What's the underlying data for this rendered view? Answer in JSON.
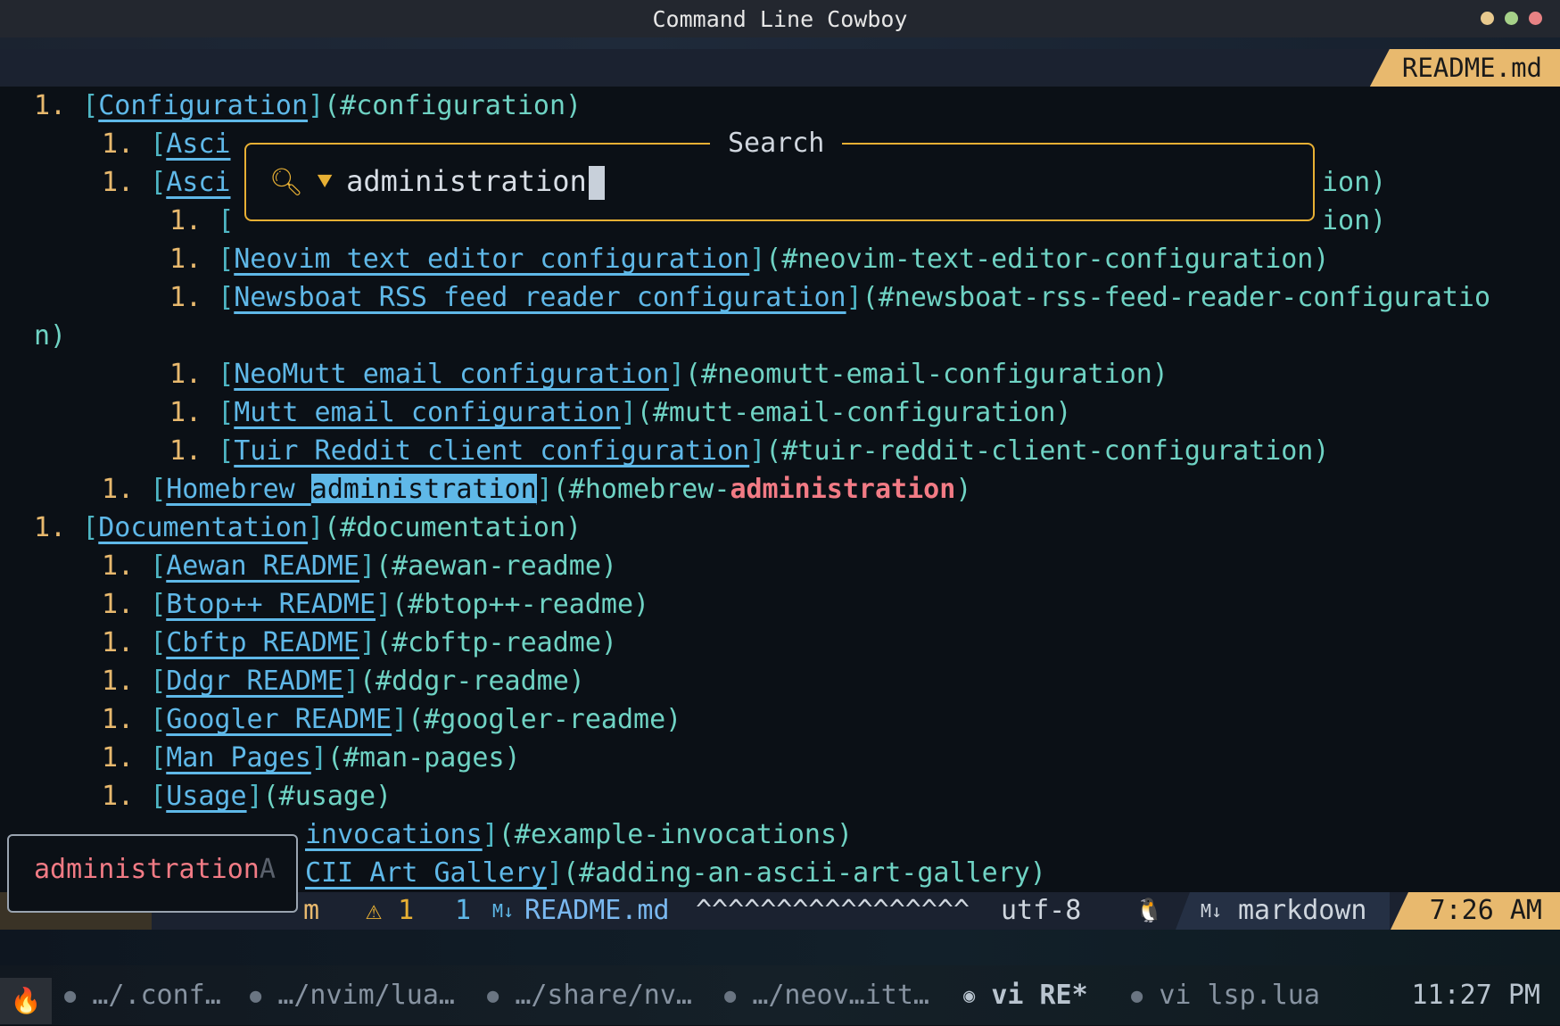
{
  "window": {
    "title": "Command Line Cowboy"
  },
  "tab": {
    "filename": "README.md"
  },
  "editor_lines": {
    "l1": {
      "num": "1. ",
      "text": "Configuration",
      "url": "(#configuration)"
    },
    "l2": {
      "num": "1. ",
      "text": "Asci"
    },
    "l3": {
      "num": "1. ",
      "text": "Asci",
      "tail": "ion)"
    },
    "l4": {
      "num": "1. ",
      "tail": "ion)"
    },
    "l5": {
      "num": "1. ",
      "text": "Neovim text editor configuration",
      "url": "(#neovim-text-editor-configuration)"
    },
    "l6": {
      "num": "1. ",
      "text": "Newsboat RSS feed reader configuration",
      "url": "(#newsboat-rss-feed-reader-configuratio"
    },
    "l6wrap": "n)",
    "l7": {
      "num": "1. ",
      "text": "NeoMutt email configuration",
      "url": "(#neomutt-email-configuration)"
    },
    "l8": {
      "num": "1. ",
      "text": "Mutt email configuration",
      "url": "(#mutt-email-configuration)"
    },
    "l9": {
      "num": "1. ",
      "text": "Tuir Reddit client configuration",
      "url": "(#tuir-reddit-client-configuration)"
    },
    "l10": {
      "num": "1. ",
      "text_a": "Homebrew ",
      "text_b": "administration",
      "url_a": "(#homebrew-",
      "url_b": "administration",
      "url_c": ")"
    },
    "l11": {
      "num": "1. ",
      "text": "Documentation",
      "url": "(#documentation)"
    },
    "l12": {
      "num": "1. ",
      "text": "Aewan README",
      "url": "(#aewan-readme)"
    },
    "l13": {
      "num": "1. ",
      "text": "Btop++ README",
      "url": "(#btop++-readme)"
    },
    "l14": {
      "num": "1. ",
      "text": "Cbftp README",
      "url": "(#cbftp-readme)"
    },
    "l15": {
      "num": "1. ",
      "text": "Ddgr README",
      "url": "(#ddgr-readme)"
    },
    "l16": {
      "num": "1. ",
      "text": "Googler README",
      "url": "(#googler-readme)"
    },
    "l17": {
      "num": "1. ",
      "text": "Man Pages",
      "url": "(#man-pages)"
    },
    "l18": {
      "num": "1. ",
      "text": "Usage",
      "url": "(#usage)"
    },
    "l19": {
      "text": "invocations",
      "url": "(#example-invocations)"
    },
    "l20": {
      "text": "CII Art Gallery",
      "url": "(#adding-an-ascii-art-gallery)"
    }
  },
  "search": {
    "title": "Search",
    "query": "administration"
  },
  "completion": {
    "match": "administration",
    "ghost": "A"
  },
  "statusline": {
    "mode": "m",
    "warn_icon": "⚠",
    "warn_count": "1",
    "hint_count": "1",
    "file_icon": "M↓",
    "filename": "README.md",
    "carets": "^^^^^^^^^^^^^^^^^",
    "encoding": "utf-8",
    "os_icon": "🐧",
    "ft_icon": "M↓",
    "filetype": "markdown",
    "time": "7:26 AM"
  },
  "tmux": {
    "session_icon": "🔥",
    "windows": [
      "…/.conf…",
      "…/nvim/lua…",
      "…/share/nv…",
      "…/neov…itt…",
      "vi RE*",
      "vi lsp.lua"
    ],
    "clock": "11:27 PM"
  },
  "colors": {
    "accent": "#e8b96e",
    "link": "#5fb8e8",
    "url": "#6fd3c4",
    "match": "#f27b85",
    "search_border": "#e8b034"
  }
}
